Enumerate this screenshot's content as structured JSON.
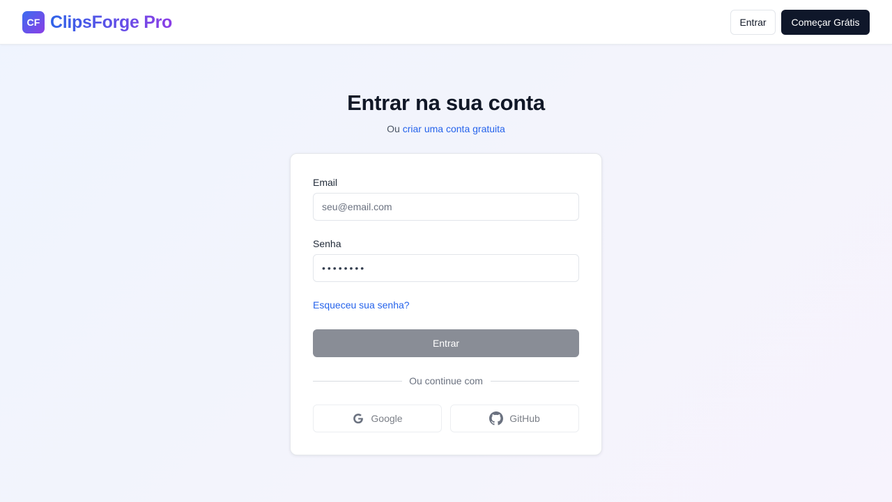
{
  "header": {
    "logo_badge": "CF",
    "brand_name": "ClipsForge Pro",
    "login_label": "Entrar",
    "signup_label": "Começar Grátis"
  },
  "page": {
    "title": "Entrar na sua conta",
    "subtitle_prefix": "Ou",
    "subtitle_link": "criar uma conta gratuita"
  },
  "form": {
    "email_label": "Email",
    "email_placeholder": "seu@email.com",
    "password_label": "Senha",
    "password_value": "password",
    "forgot_label": "Esqueceu sua senha?",
    "submit_label": "Entrar",
    "divider_text": "Ou continue com",
    "google_label": "Google",
    "github_label": "GitHub"
  },
  "icons": {
    "google": "google-icon",
    "github": "github-icon"
  },
  "colors": {
    "brand_start": "#2f63e8",
    "brand_end": "#8b3ee6",
    "link": "#2563eb",
    "primary_dark": "#0f172a",
    "submit_disabled": "#898d96"
  }
}
